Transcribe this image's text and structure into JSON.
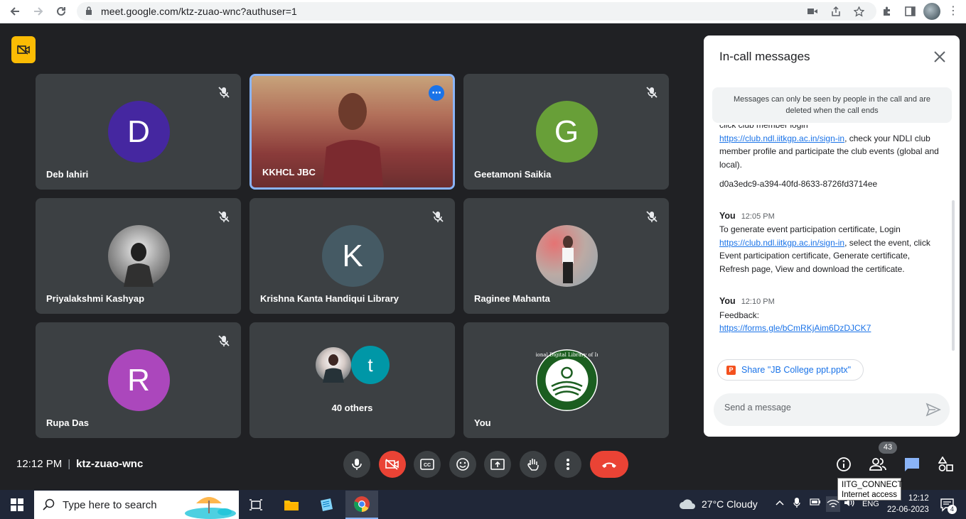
{
  "browser": {
    "url": "meet.google.com/ktz-zuao-wnc?authuser=1"
  },
  "tiles": [
    {
      "name": "Deb lahiri",
      "initial": "D",
      "color": "#4527a0",
      "muted": true
    },
    {
      "name": "KKHCL JBC",
      "video": true,
      "active": true
    },
    {
      "name": "Geetamoni Saikia",
      "initial": "G",
      "color": "#689f38",
      "muted": true
    },
    {
      "name": "Priyalakshmi Kashyap",
      "photo": true,
      "muted": true
    },
    {
      "name": "Krishna Kanta Handiqui Library",
      "initial": "K",
      "color": "#455a64",
      "muted": true
    },
    {
      "name": "Raginee Mahanta",
      "photo": true,
      "muted": true
    },
    {
      "name": "Rupa Das",
      "initial": "R",
      "color": "#ab47bc",
      "muted": true
    },
    {
      "name": "40 others",
      "group_initial": "t",
      "group_color": "#0097a7"
    },
    {
      "name": "You",
      "logo_text": "National Digital Library of India"
    }
  ],
  "meeting": {
    "time": "12:12 PM",
    "code": "ktz-zuao-wnc",
    "participant_count": "43"
  },
  "chat": {
    "title": "In-call messages",
    "notice": "Messages can only be seen by people in the call and are deleted when the call ends",
    "partial_top": "click club member login",
    "msg0_link": "https://club.ndl.iitkgp.ac.in/sign-in",
    "msg0_text": ", check your NDLI club member profile and participate the club events (global and local).",
    "code_line": "d0a3edc9-a394-40fd-8633-8726fd3714ee",
    "messages": [
      {
        "sender": "You",
        "time": "12:05 PM",
        "pre": "To generate event participation certificate, Login",
        "link": "https://club.ndl.iitkgp.ac.in/sign-in",
        "post": ", select the event, click Event participation certificate, Generate certificate, Refresh page, View and download the certificate."
      },
      {
        "sender": "You",
        "time": "12:10 PM",
        "pre": "Feedback:",
        "link": "https://forms.gle/bCmRKjAim6DzDJCK7",
        "post": ""
      }
    ],
    "share_label": "Share \"JB College ppt.pptx\"",
    "input_placeholder": "Send a message"
  },
  "tooltip": {
    "line1": "IITG_CONNECT",
    "line2": "Internet access"
  },
  "taskbar": {
    "search_placeholder": "Type here to search",
    "weather": "27°C  Cloudy",
    "lang": "ENG",
    "time": "12:12",
    "date": "22-06-2023",
    "notif_count": "4"
  }
}
